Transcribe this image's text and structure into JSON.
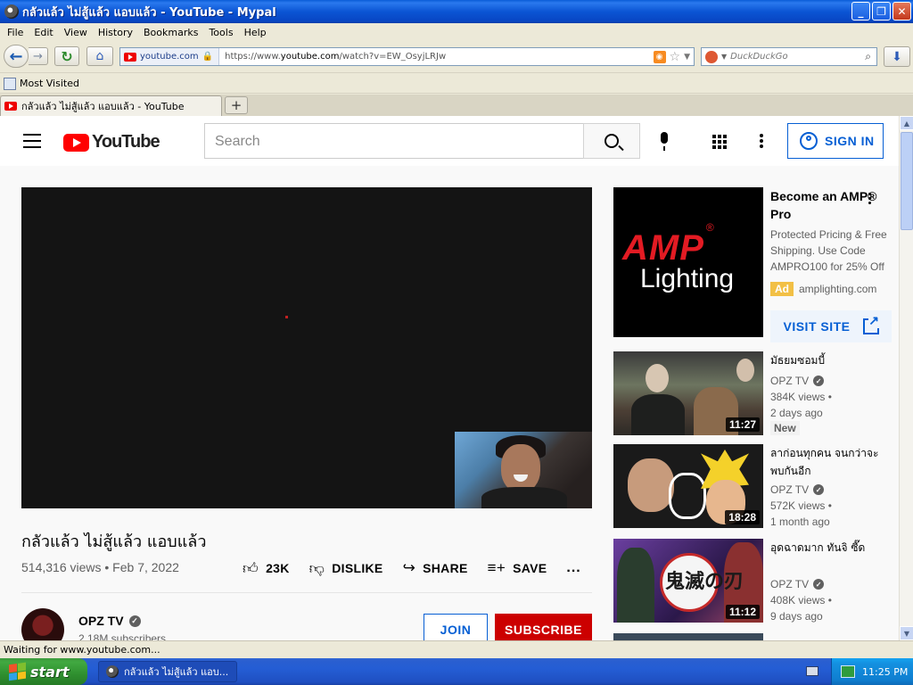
{
  "window": {
    "title": "กลัวแล้ว ไม่สู้แล้ว แอบแล้ว - YouTube - Mypal",
    "minimize": "_",
    "restore": "❐",
    "close": "✕"
  },
  "menu": [
    "File",
    "Edit",
    "View",
    "History",
    "Bookmarks",
    "Tools",
    "Help"
  ],
  "nav": {
    "site_identity": "youtube.com",
    "url_prefix": "https://www.",
    "url_domain": "youtube.com",
    "url_path": "/watch?v=EW_OsyjLRJw",
    "search_engine_placeholder": "DuckDuckGo"
  },
  "bookmarks": {
    "most_visited": "Most Visited"
  },
  "tabs": [
    {
      "label": "กลัวแล้ว ไม่สู้แล้ว แอบแล้ว - YouTube"
    }
  ],
  "youtube": {
    "logo_text": "YouTube",
    "search_placeholder": "Search",
    "sign_in": "SIGN IN",
    "video": {
      "title": "กลัวแล้ว ไม่สู้แล้ว แอบแล้ว",
      "meta": "514,316 views • Feb 7, 2022",
      "likes": "23K",
      "dislike": "DISLIKE",
      "share": "SHARE",
      "save": "SAVE",
      "more": "..."
    },
    "channel": {
      "name": "OPZ TV",
      "subscribers": "2.18M subscribers",
      "join": "JOIN",
      "subscribe": "SUBSCRIBE"
    },
    "ad": {
      "brand_big": "AMP",
      "brand_mark": "®",
      "brand_sub": "Lighting",
      "title": "Become an AMP® Pro",
      "description": "Protected Pricing & Free Shipping. Use Code AMPRO100 for 25% Off",
      "badge": "Ad",
      "domain": "amplighting.com",
      "cta": "VISIT SITE"
    },
    "recommendations": [
      {
        "title": "มัธยมซอมบี้",
        "channel": "OPZ TV",
        "views": "384K views •",
        "age": "2 days ago",
        "badge": "New",
        "duration": "11:27"
      },
      {
        "title": "ลาก่อนทุกคน จนกว่าจะพบกันอีก",
        "channel": "OPZ TV",
        "views": "572K views •",
        "age": "1 month ago",
        "duration": "18:28"
      },
      {
        "title": "อุดฉาดมาก ทันจิ ซี๊ด",
        "channel": "OPZ TV",
        "views": "408K views •",
        "age": "9 days ago",
        "duration": "11:12",
        "thumb_text": "鬼滅の刃"
      }
    ]
  },
  "status": {
    "text": "Waiting for www.youtube.com..."
  },
  "taskbar": {
    "start": "start",
    "item": "กลัวแล้ว ไม่สู้แล้ว แอบ...",
    "clock": "11:25 PM"
  }
}
